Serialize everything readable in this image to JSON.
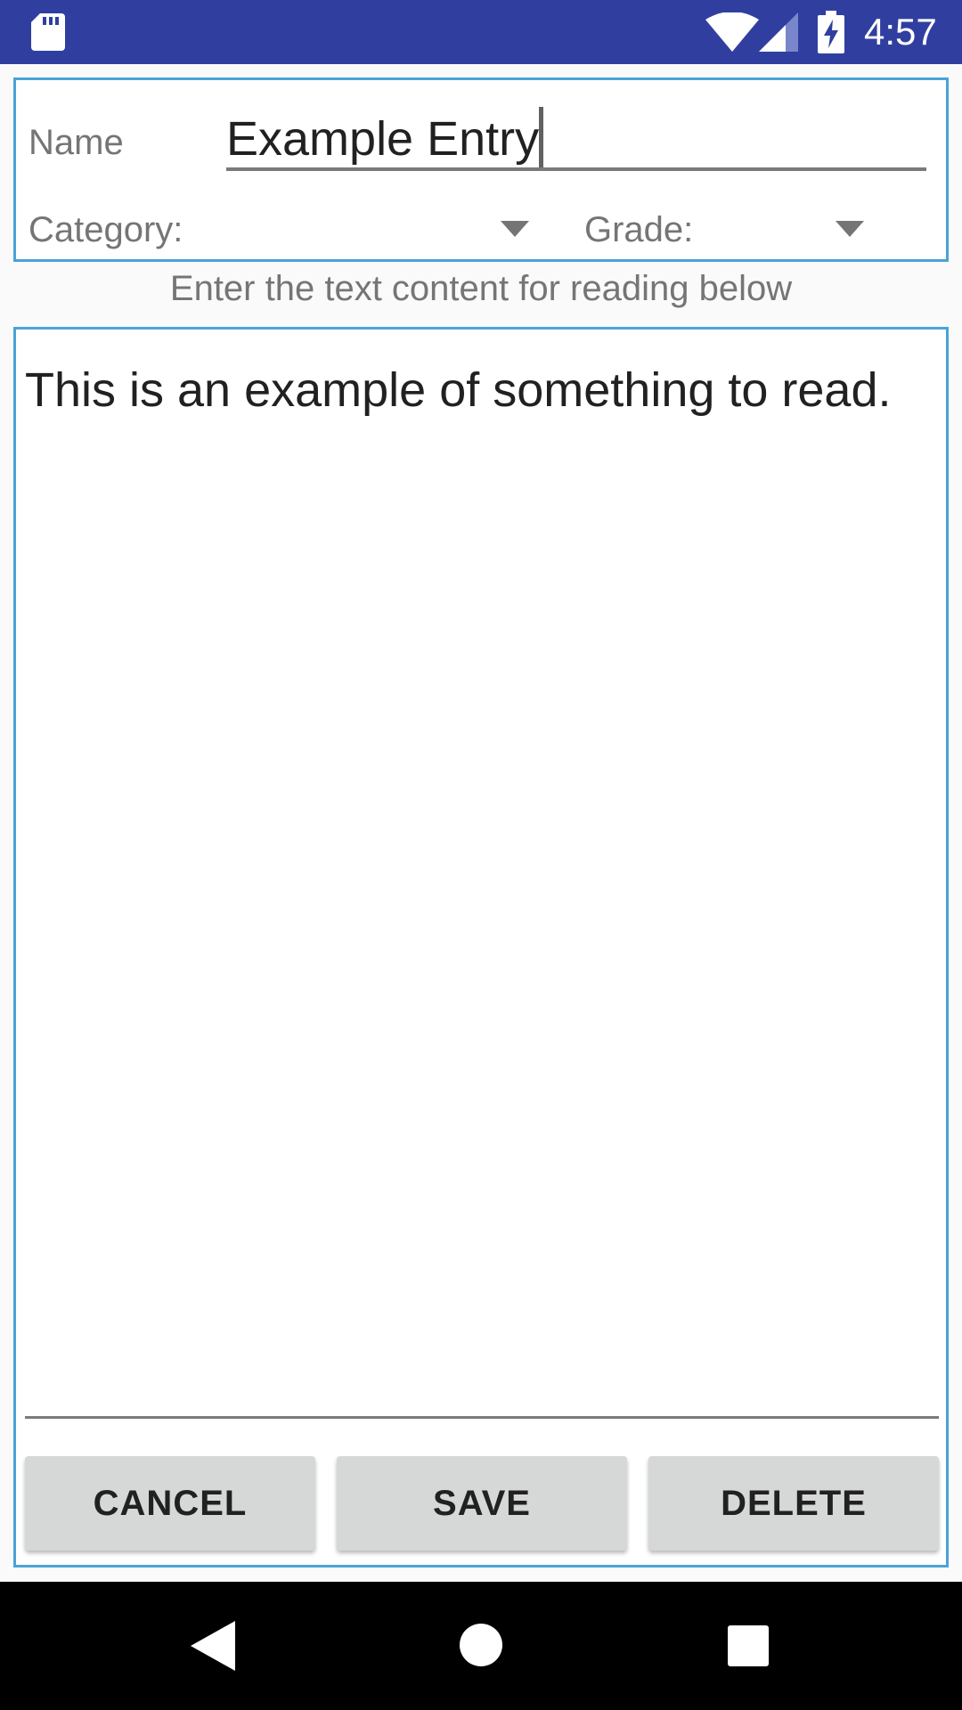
{
  "status_bar": {
    "time": "4:57",
    "icons": [
      "sd-card-icon",
      "wifi-icon",
      "cell-signal-icon",
      "battery-charging-icon"
    ],
    "background_color": "#303f9f"
  },
  "form": {
    "name_label": "Name",
    "name_value": "Example Entry",
    "category_label": "Category:",
    "grade_label": "Grade:",
    "instruction": "Enter the text content for reading below",
    "content_text": "This is an example of something to read.",
    "accent_color": "#4aa3d8"
  },
  "buttons": {
    "cancel": "CANCEL",
    "save": "SAVE",
    "delete": "DELETE"
  },
  "nav_bar": {
    "icons": [
      "back-icon",
      "home-icon",
      "recents-icon"
    ]
  }
}
